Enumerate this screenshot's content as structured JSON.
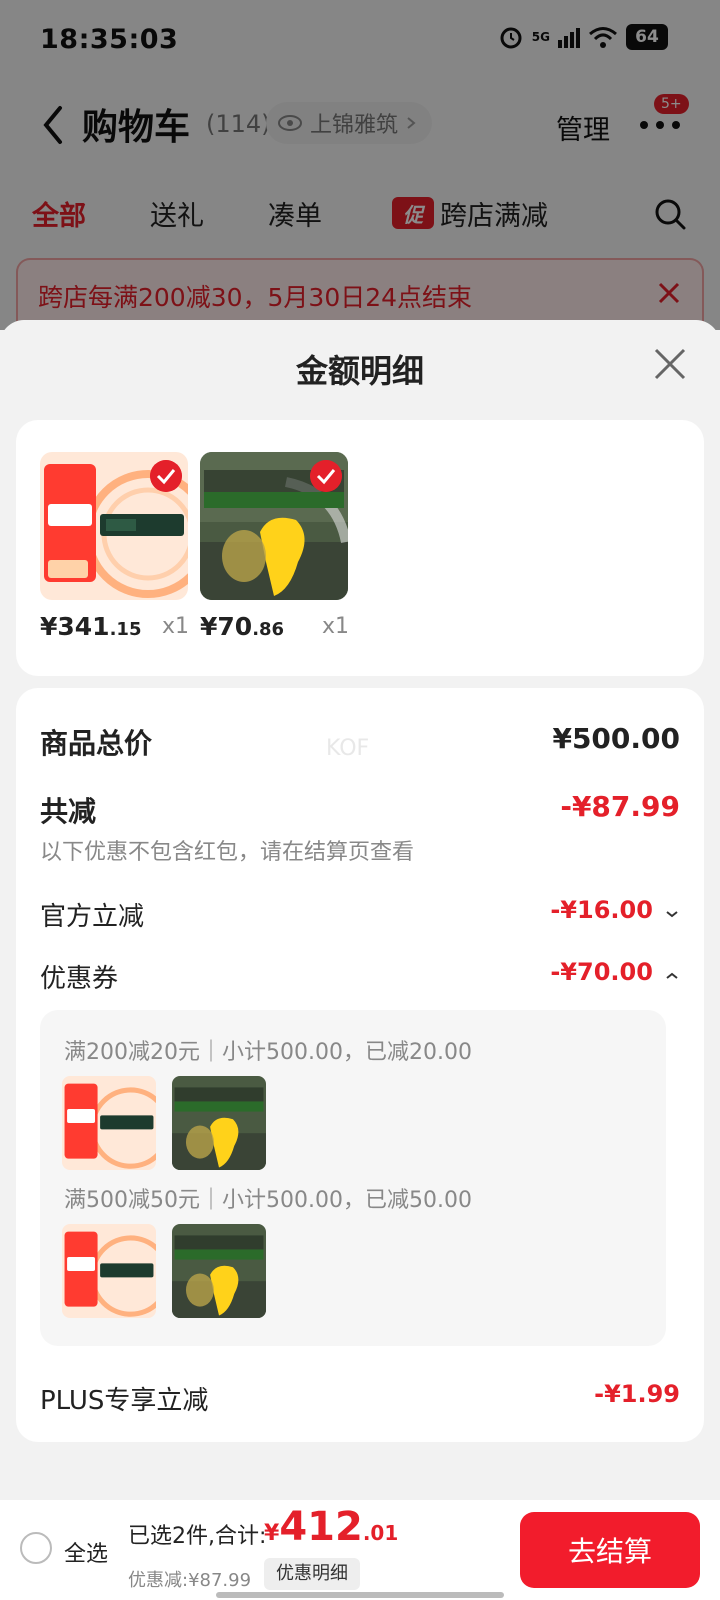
{
  "status_bar": {
    "time": "18:35:03",
    "network": "5G",
    "battery": "64"
  },
  "cart_header": {
    "title": "购物车",
    "count": "(114)",
    "location": "上锦雅筑",
    "manage": "管理",
    "more_badge": "5+"
  },
  "cart_tabs": [
    "全部",
    "送礼",
    "凑单",
    "跨店满减"
  ],
  "promo_tag": "促",
  "notice": "跨店每满200减30，5月30日24点结束",
  "sheet": {
    "title": "金额明细",
    "products": [
      {
        "price_int": "¥341",
        "price_dec": ".15",
        "qty": "x1"
      },
      {
        "price_int": "¥70",
        "price_dec": ".86",
        "qty": "x1"
      }
    ],
    "product_total": {
      "label": "商品总价",
      "value": "¥500.00"
    },
    "total_discount": {
      "label": "共减",
      "value": "-¥87.99",
      "note": "以下优惠不包含红包，请在结算页查看"
    },
    "official_discount": {
      "label": "官方立减",
      "value": "-¥16.00"
    },
    "coupon": {
      "label": "优惠券",
      "value": "-¥70.00",
      "lines": [
        "满200减20元｜小计500.00，已减20.00",
        "满500减50元｜小计500.00，已减50.00"
      ]
    },
    "plus_discount": {
      "label": "PLUS专享立减",
      "value": "-¥1.99"
    },
    "watermark": "KOF"
  },
  "bottom_bar": {
    "select_all": "全选",
    "selected_summary": "已选2件,合计:",
    "total_symbol": "¥",
    "total_int": "412",
    "total_dec": ".01",
    "discount_text": "优惠减:¥87.99",
    "discount_detail_button": "优惠明细",
    "checkout_button": "去结算"
  },
  "colors": {
    "accent": "#e4202a",
    "checkout": "#f21c2c"
  },
  "icons": [
    "back-icon",
    "eye-icon",
    "more-icon",
    "search-icon",
    "close-icon",
    "check-icon",
    "chevron-down-icon",
    "chevron-up-icon"
  ]
}
